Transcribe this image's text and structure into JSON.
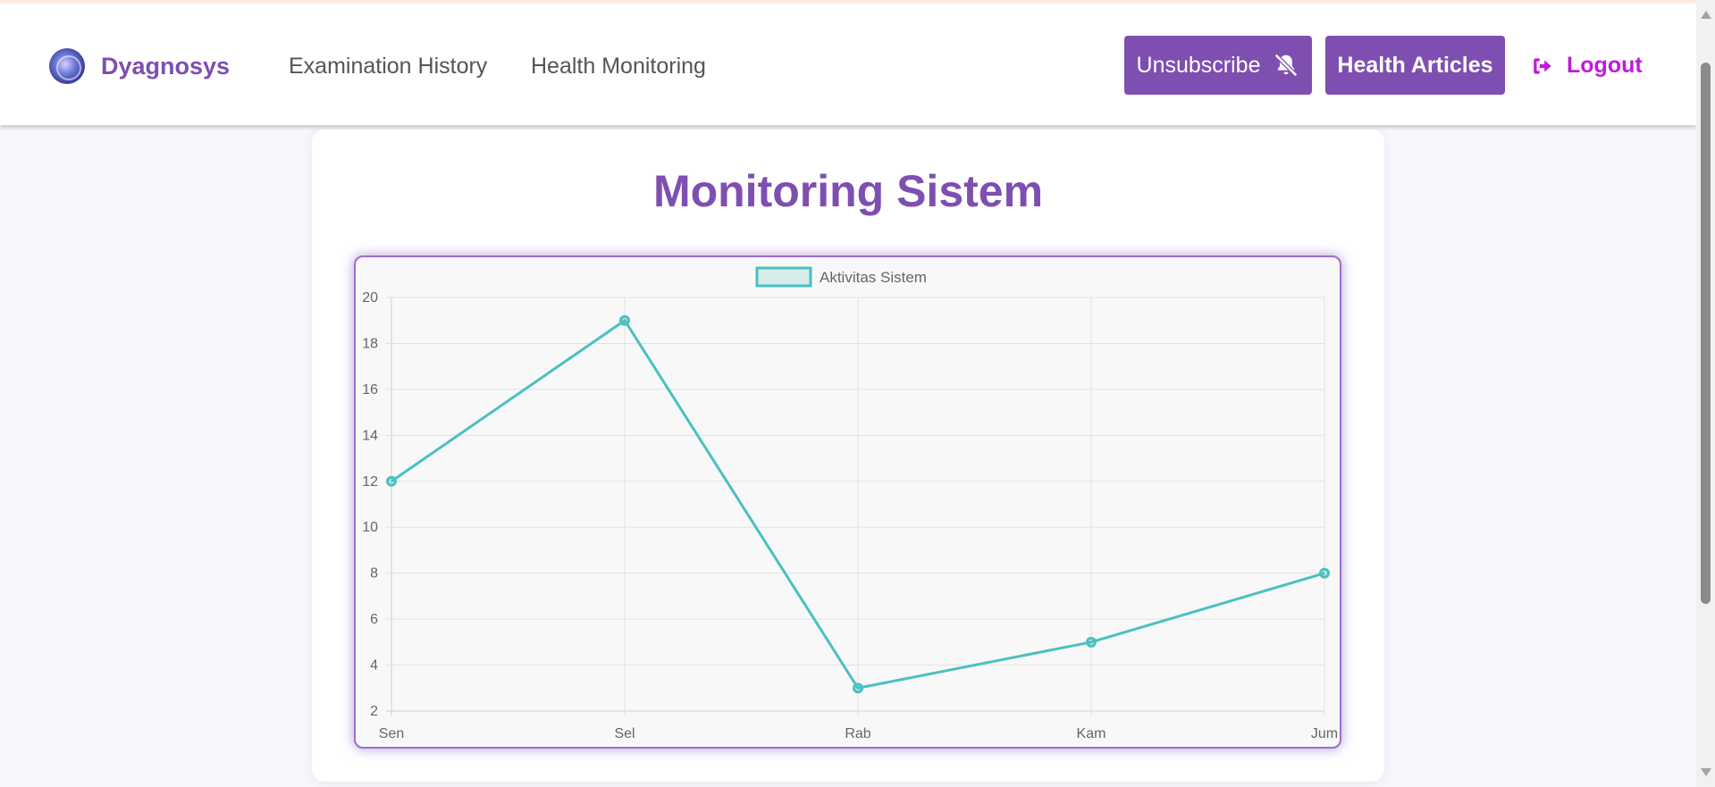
{
  "navbar": {
    "brand": "Dyagnosys",
    "links": [
      "Examination History",
      "Health Monitoring"
    ],
    "unsubscribe_label": "Unsubscribe",
    "articles_label": "Health Articles",
    "logout_label": "Logout"
  },
  "main": {
    "title": "Monitoring Sistem"
  },
  "colors": {
    "accent": "#7e4fb0",
    "logout": "#c218e0",
    "series": "#4bc0c0"
  },
  "icons": [
    "bell-slash-icon",
    "logout-icon",
    "logo-icon"
  ],
  "chart_data": {
    "type": "line",
    "categories": [
      "Sen",
      "Sel",
      "Rab",
      "Kam",
      "Jum"
    ],
    "series": [
      {
        "name": "Aktivitas Sistem",
        "values": [
          12,
          19,
          3,
          5,
          8
        ]
      }
    ],
    "ylim": [
      2,
      20
    ],
    "yticks": [
      2,
      4,
      6,
      8,
      10,
      12,
      14,
      16,
      18,
      20
    ],
    "grid": true,
    "legend": "top-center"
  }
}
